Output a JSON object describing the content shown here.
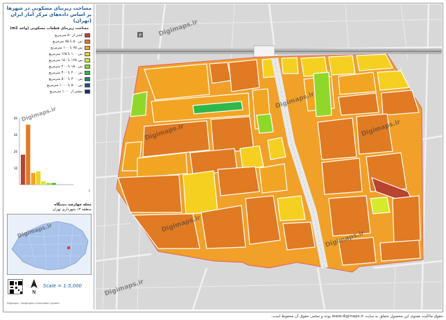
{
  "panel": {
    "title_line1": "مساحت زیربنای مسکونی در شهرها",
    "title_line2": "بر اساس داده‌های مرکز آمار ایران (تهران)",
    "legend_title": "مساحت زیربنای قطعات مسکونی (واحد m2)",
    "legend_items": [
      {
        "label": "کمتر از ۵۰ مترمربع",
        "color": "#b8432e"
      },
      {
        "label": "بین ۵۰ تا ۷۵ مترمربع",
        "color": "#e07a23"
      },
      {
        "label": "بین ۷۵ تا ۱۰۰ مترمربع",
        "color": "#f2a523"
      },
      {
        "label": "بین ۱۰۰ تا ۱۲۵ مترمربع",
        "color": "#f6d020"
      },
      {
        "label": "بین ۱۲۵ تا ۱۵۰ مترمربع",
        "color": "#d4ea2a"
      },
      {
        "label": "بین ۱۵۰ تا ۲۰۰ مترمربع",
        "color": "#8fd82a"
      },
      {
        "label": "بین ۲۰۰ تا ۳۰۰ مترمربع",
        "color": "#2fb84a"
      },
      {
        "label": "بین ۳۰۰ تا ۵۰۰ مترمربع",
        "color": "#1b8a6a"
      },
      {
        "label": "بین ۵۰۰ تا ۱۰۰۰ مترمربع",
        "color": "#1f4f8f"
      },
      {
        "label": "بیشتر از ۱۰۰۰ مترمربع",
        "color": "#17306b"
      }
    ],
    "chart_caption": "توزیع مساحت زیربنای قطعات مسکونی در محله (درصد)",
    "locator_title": "محله چهارصد دستگاه",
    "locator_subtitle": "منطقه ۱۳ شهرداری تهران",
    "scale_text": "Scale = 1:5,000",
    "north_label": "N",
    "small_credit": "Digimaps - Geographic Information System"
  },
  "watermark": "Digimaps.ir",
  "footer": "حقوق مالکیت معنوی این محصول متعلق به سایت www.digimaps.ir بوده و تمامی حقوق آن محفوظ است.",
  "chart_data": {
    "type": "bar",
    "categories": [
      "<50",
      "50-75",
      "75-100",
      "100-125",
      "125-150",
      "150-200",
      "200-300",
      "300-500",
      "500-1000",
      ">1000"
    ],
    "values": [
      18,
      36,
      7,
      8,
      2,
      1,
      1,
      0,
      0,
      0
    ],
    "colors": [
      "#b8432e",
      "#e07a23",
      "#f2a523",
      "#f6d020",
      "#d4ea2a",
      "#8fd82a",
      "#2fb84a",
      "#1b8a6a",
      "#1f4f8f",
      "#17306b"
    ],
    "ylim": [
      0,
      40
    ],
    "yticks": [
      "40",
      "30",
      "20",
      "10"
    ]
  }
}
